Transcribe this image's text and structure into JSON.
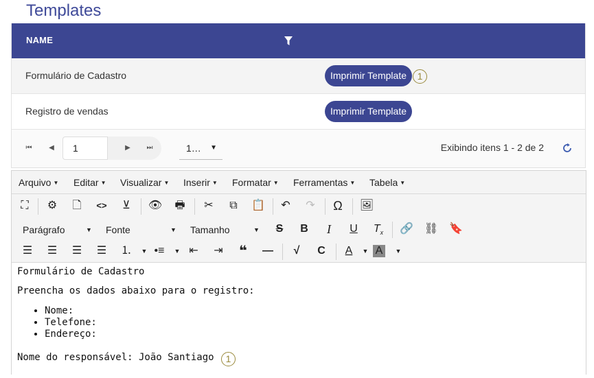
{
  "page": {
    "title": "Templates"
  },
  "grid": {
    "column_name": "NAME",
    "rows": [
      {
        "name": "Formulário de Cadastro",
        "button": "Imprimir Template",
        "badge": "1"
      },
      {
        "name": "Registro de vendas",
        "button": "Imprimir Template"
      }
    ]
  },
  "pager": {
    "page": "1",
    "page_size": "1…",
    "info": "Exibindo itens 1 - 2 de 2"
  },
  "editor": {
    "menu": [
      "Arquivo",
      "Editar",
      "Visualizar",
      "Inserir",
      "Formatar",
      "Ferramentas",
      "Tabela"
    ],
    "paragraph": "Parágrafo",
    "font": "Fonte",
    "size": "Tamanho",
    "content": {
      "title": "Formulário de Cadastro",
      "intro": "Preencha os dados abaixo para o registro:",
      "items": [
        "Nome:",
        "Telefone:",
        "Endereço:"
      ],
      "responsible": "Nome do responsável: João Santiago",
      "badge": "1"
    }
  },
  "colors": {
    "header": "#3c4692",
    "title": "#3f4a99",
    "badge": "#9a8a3c"
  }
}
